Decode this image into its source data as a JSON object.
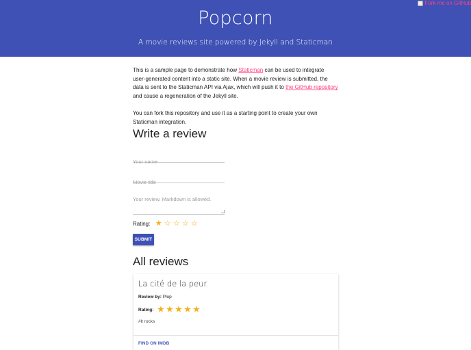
{
  "header": {
    "title": "Popcorn",
    "subtitle": "A movie reviews site powered by Jekyll and Staticman",
    "fork_ribbon_alt": "Fork me on GitHub"
  },
  "intro": {
    "p1_before_link1": "This is a sample page to demonstrate how ",
    "link1": "Staticman",
    "p1_after_link1": " can be used to integrate user-generated content into a static site. When a movie review is submitted, the data is sent to the Staticman API via Ajax, which will push it to ",
    "link2": "the GitHub repository",
    "p1_after_link2": " and cause a regeneration of the Jekyll site.",
    "p2": "You can fork this repository and use it as a starting point to create your own Staticman integration."
  },
  "form": {
    "heading": "Write a review",
    "name_placeholder": "Your name",
    "movie_placeholder": "Movie title",
    "review_placeholder": "Your review. Markdown is allowed.",
    "rating_label": "Rating:",
    "rating_value": 1,
    "rating_max": 5,
    "submit_label": "SUBMIT"
  },
  "reviews": {
    "heading": "All reviews",
    "items": [
      {
        "title": "La cité de la peur",
        "review_by_label": "Review by:",
        "review_by": "Plop",
        "rating_label": "Rating:",
        "rating": 5,
        "body": "#lt rocks",
        "action": "FIND ON IMDB"
      }
    ]
  },
  "colors": {
    "primary": "#3f51b5",
    "accent": "#ff4081",
    "star": "#f2b01e"
  }
}
